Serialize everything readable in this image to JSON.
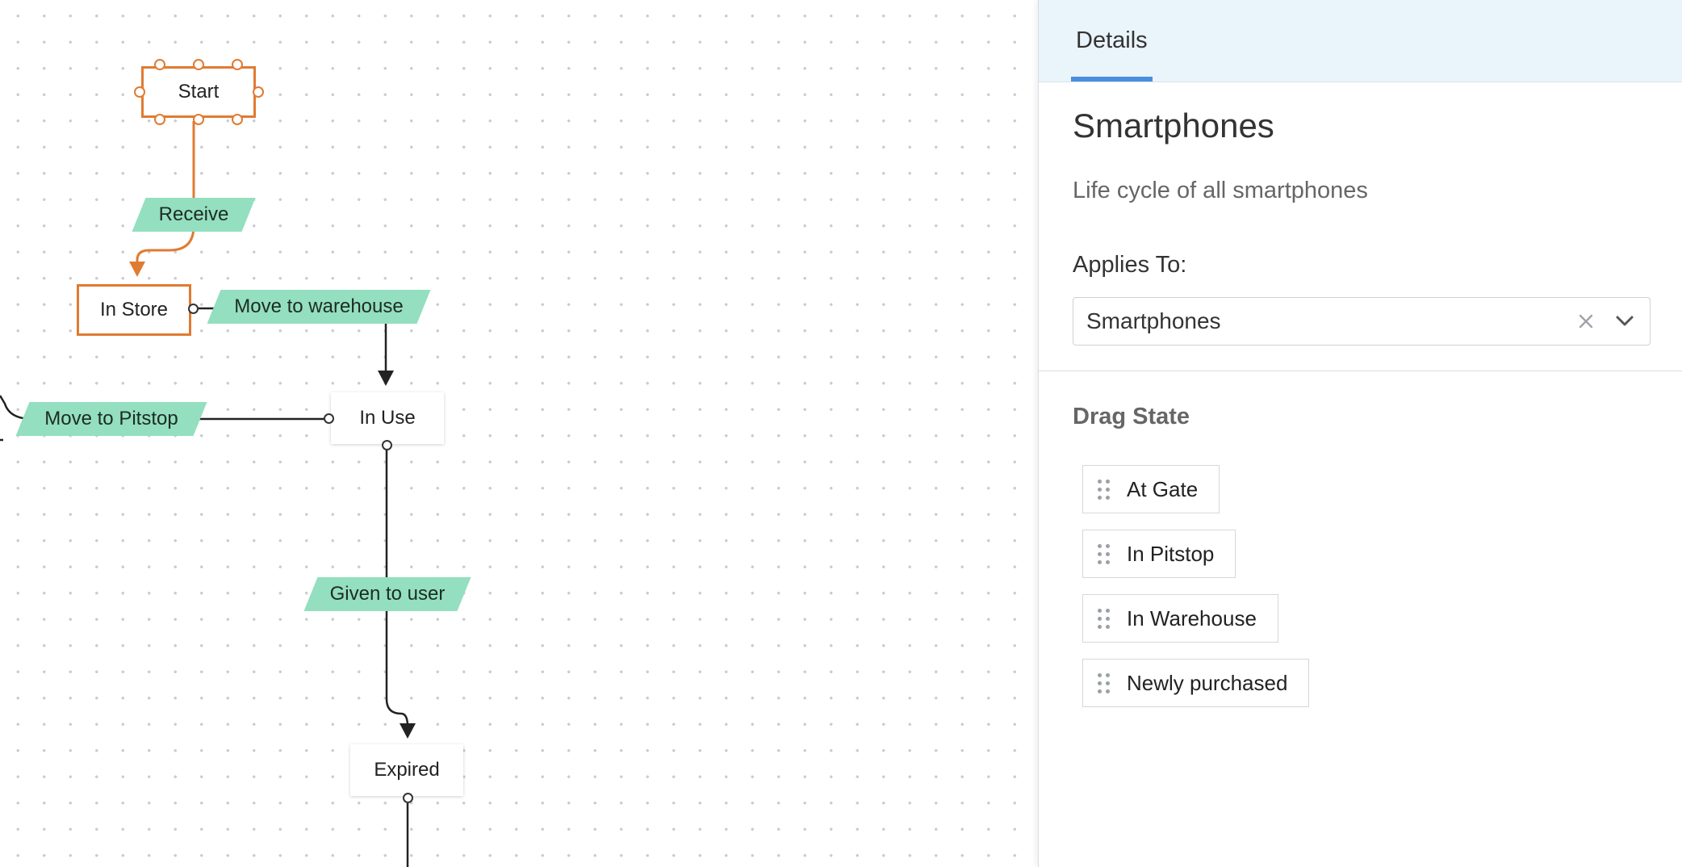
{
  "canvas": {
    "nodes": {
      "start": "Start",
      "in_store": "In Store",
      "in_use": "In Use",
      "expired": "Expired"
    },
    "transitions": {
      "receive": "Receive",
      "move_to_warehouse": "Move to warehouse",
      "move_to_pitstop": "Move to Pitstop",
      "given_to_user": "Given to user"
    }
  },
  "details": {
    "tab_label": "Details",
    "title": "Smartphones",
    "description": "Life cycle of all smartphones",
    "applies_to_label": "Applies To:",
    "applies_to_value": "Smartphones",
    "drag_state_heading": "Drag State",
    "drag_states": [
      "At Gate",
      "In Pitstop",
      "In Warehouse",
      "Newly purchased"
    ]
  },
  "colors": {
    "accent_orange": "#e07b32",
    "transition_green": "#93dfbf",
    "tab_indicator": "#4a8ede"
  }
}
